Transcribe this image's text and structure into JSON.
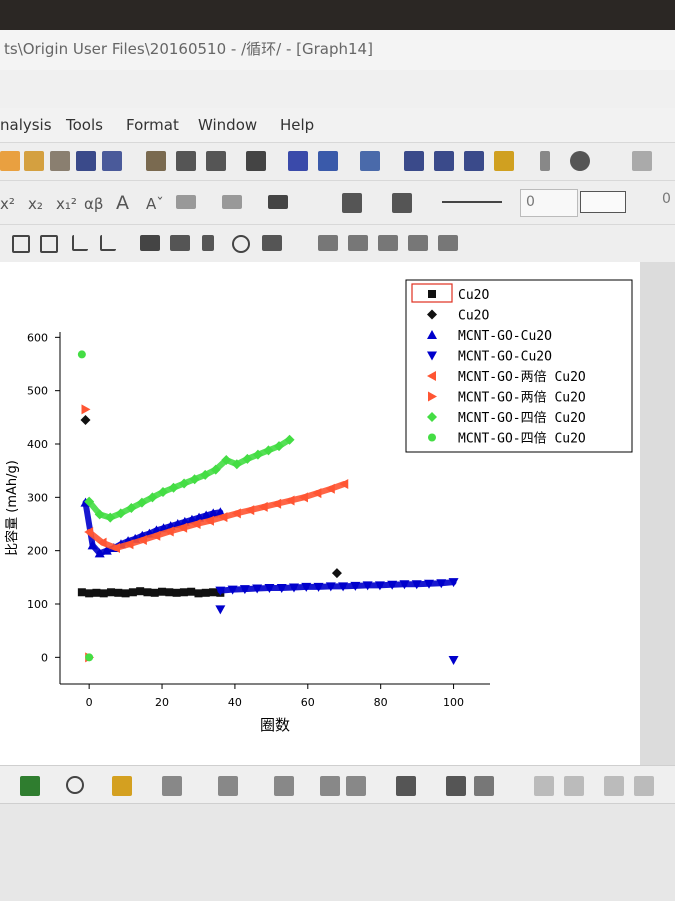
{
  "window": {
    "title": "ts\\Origin User Files\\20160510 - /循环/ - [Graph14]"
  },
  "menu": [
    "nalysis",
    "Tools",
    "Format",
    "Window",
    "Help"
  ],
  "toolbar_format": {
    "glyphs": [
      "x²",
      "x₂",
      "x₁²",
      "αβ",
      "A",
      "Aˇ"
    ],
    "number_field_1": "0",
    "number_field_2": "0"
  },
  "chart_data": {
    "type": "scatter",
    "xlabel": "圈数",
    "ylabel": "比容量 (mAh/g)",
    "xlim": [
      -8,
      110
    ],
    "ylim": [
      -50,
      610
    ],
    "xticks": [
      0,
      20,
      40,
      60,
      80,
      100
    ],
    "yticks": [
      0,
      100,
      200,
      300,
      400,
      500,
      600
    ],
    "grid": false,
    "legend_position": "top-right",
    "series": [
      {
        "name": "Cu2O",
        "marker": "square",
        "color": "#111111",
        "x_range": [
          -2,
          36
        ],
        "values": [
          122,
          120,
          121,
          120,
          122,
          121,
          120,
          122,
          124,
          122,
          121,
          123,
          122,
          121,
          122,
          123,
          120,
          121,
          122,
          121
        ]
      },
      {
        "name": "Cu2O",
        "marker": "diamond",
        "color": "#111111",
        "points": [
          [
            -1,
            445
          ],
          [
            68,
            158
          ]
        ]
      },
      {
        "name": "MCNT-GO-Cu2O",
        "marker": "triangle-up",
        "color": "#0000cc",
        "x_range": [
          -1,
          36
        ],
        "values": [
          290,
          210,
          195,
          200,
          205,
          212,
          218,
          222,
          228,
          232,
          238,
          242,
          246,
          250,
          254,
          258,
          262,
          266,
          270,
          272
        ]
      },
      {
        "name": "MCNT-GO-Cu2O",
        "marker": "triangle-down",
        "color": "#0000cc",
        "x_range": [
          36,
          100
        ],
        "values": [
          125,
          127,
          128,
          129,
          130,
          130,
          131,
          132,
          132,
          133,
          133,
          134,
          135,
          135,
          136,
          137,
          137,
          138,
          139,
          141
        ],
        "extra_points": [
          [
            36,
            90
          ],
          [
            100,
            -5
          ]
        ]
      },
      {
        "name": "MCNT-GO-两倍 Cu2O",
        "marker": "triangle-left",
        "color": "#ff5533",
        "x_range": [
          0,
          70
        ],
        "values": [
          235,
          215,
          205,
          212,
          220,
          228,
          236,
          243,
          250,
          256,
          263,
          270,
          276,
          282,
          288,
          294,
          300,
          308,
          316,
          325
        ]
      },
      {
        "name": "MCNT-GO-两倍 Cu2O",
        "marker": "triangle-right",
        "color": "#ff5533",
        "points": [
          [
            -1,
            465
          ],
          [
            0,
            0
          ]
        ]
      },
      {
        "name": "MCNT-GO-四倍 Cu2O",
        "marker": "diamond",
        "color": "#44dd44",
        "x_range": [
          0,
          55
        ],
        "values": [
          292,
          268,
          262,
          270,
          280,
          290,
          300,
          310,
          318,
          326,
          334,
          342,
          352,
          370,
          362,
          372,
          380,
          388,
          396,
          408
        ]
      },
      {
        "name": "MCNT-GO-四倍 Cu2O",
        "marker": "circle",
        "color": "#44dd44",
        "points": [
          [
            -2,
            568
          ],
          [
            0,
            0
          ]
        ]
      }
    ]
  }
}
